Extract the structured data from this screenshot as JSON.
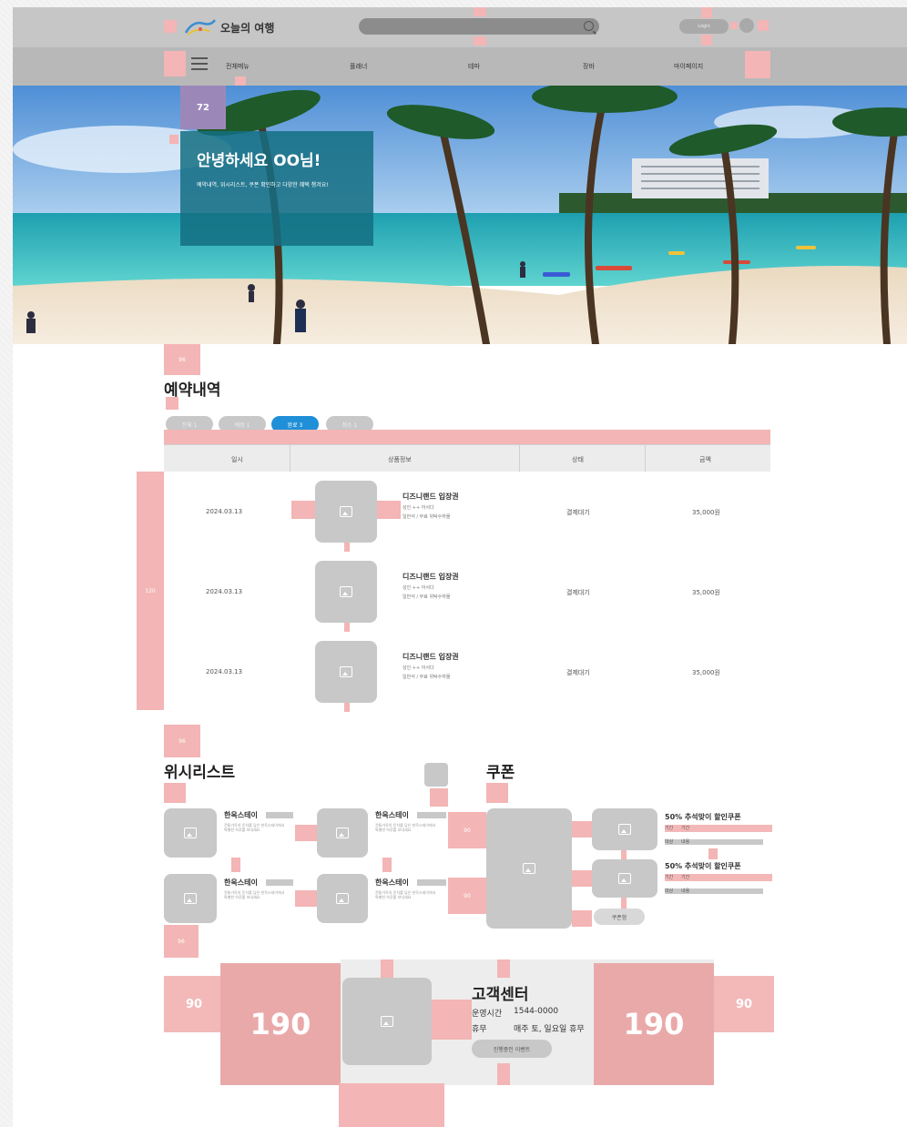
{
  "header": {
    "logo_text": "오늘의 여행",
    "logo_mark_text": "오늘",
    "search_placeholder": "",
    "login_label": "Login"
  },
  "nav": {
    "items": [
      "전체메뉴",
      "플래너",
      "테마",
      "장바",
      "마이페이지"
    ]
  },
  "hero": {
    "badge": "72",
    "welcome_title": "안녕하세요 OO님!",
    "welcome_text": "예약내역, 위시리스트, 쿠폰 확인하고 다양한 혜택 챙겨요!"
  },
  "reservation": {
    "title": "예약내역",
    "tabs": [
      "전체 1",
      "예정 1",
      "완료 3",
      "취소 1"
    ],
    "active_tab": 2,
    "columns": [
      "일시",
      "상품정보",
      "상태",
      "금액"
    ],
    "rows": [
      {
        "date": "2024.03.13",
        "title": "디즈니랜드 입장권",
        "sub1": "성인 ++ 어서다",
        "sub2": "일반석 / 무료 위탁수하물",
        "status": "결제대기",
        "price": "35,000원"
      },
      {
        "date": "2024.03.13",
        "title": "디즈니랜드 입장권",
        "sub1": "성인 ++ 어서다",
        "sub2": "일반석 / 무료 위탁수하물",
        "status": "결제대기",
        "price": "35,000원"
      },
      {
        "date": "2024.03.13",
        "title": "디즈니랜드 입장권",
        "sub1": "성인 ++ 어서다",
        "sub2": "일반석 / 무료 위탁수하물",
        "status": "결제대기",
        "price": "35,000원"
      }
    ]
  },
  "wishlist": {
    "title": "위시리스트",
    "items": [
      {
        "title": "한옥스테이",
        "desc": "전통가옥의 운치를 담은 한옥스테이에서 특별한 하루를 보내세요"
      },
      {
        "title": "한옥스테이",
        "desc": "전통가옥의 운치를 담은 한옥스테이에서 특별한 하루를 보내세요"
      },
      {
        "title": "한옥스테이",
        "desc": "전통가옥의 운치를 담은 한옥스테이에서 특별한 하루를 보내세요"
      },
      {
        "title": "한옥스테이",
        "desc": "전통가옥의 운치를 담은 한옥스테이에서 특별한 하루를 보내세요"
      }
    ]
  },
  "coupon": {
    "title": "쿠폰",
    "items": [
      {
        "title": "50% 추석맞이 할인쿠폰",
        "period_label": "기간",
        "period_value": "기간",
        "target_label": "대상",
        "target_value": "내용"
      },
      {
        "title": "50% 추석맞이 할인쿠폰",
        "period_label": "기간",
        "period_value": "기간",
        "target_label": "대상",
        "target_value": "내용"
      }
    ],
    "button": "쿠폰함"
  },
  "customer_center": {
    "title": "고객센터",
    "hours_label": "운영시간",
    "hours_value": "1544-0000",
    "holiday_label": "휴무",
    "holiday_value": "매주 토, 일요일 휴무",
    "button": "진행중인 이벤트"
  },
  "spacing_labels": {
    "big_left": "190",
    "big_right": "190",
    "side_left": "90",
    "side_right": "90",
    "gap_96a": "96",
    "gap_96b": "96",
    "gap_96c": "96",
    "row_gap": "120",
    "wish_gap": "90"
  },
  "colors": {
    "accent": "#1f8fd8",
    "spacing_marker": "#f3b5b5",
    "welcome_panel": "#146e82",
    "badge": "#9b88b9"
  }
}
